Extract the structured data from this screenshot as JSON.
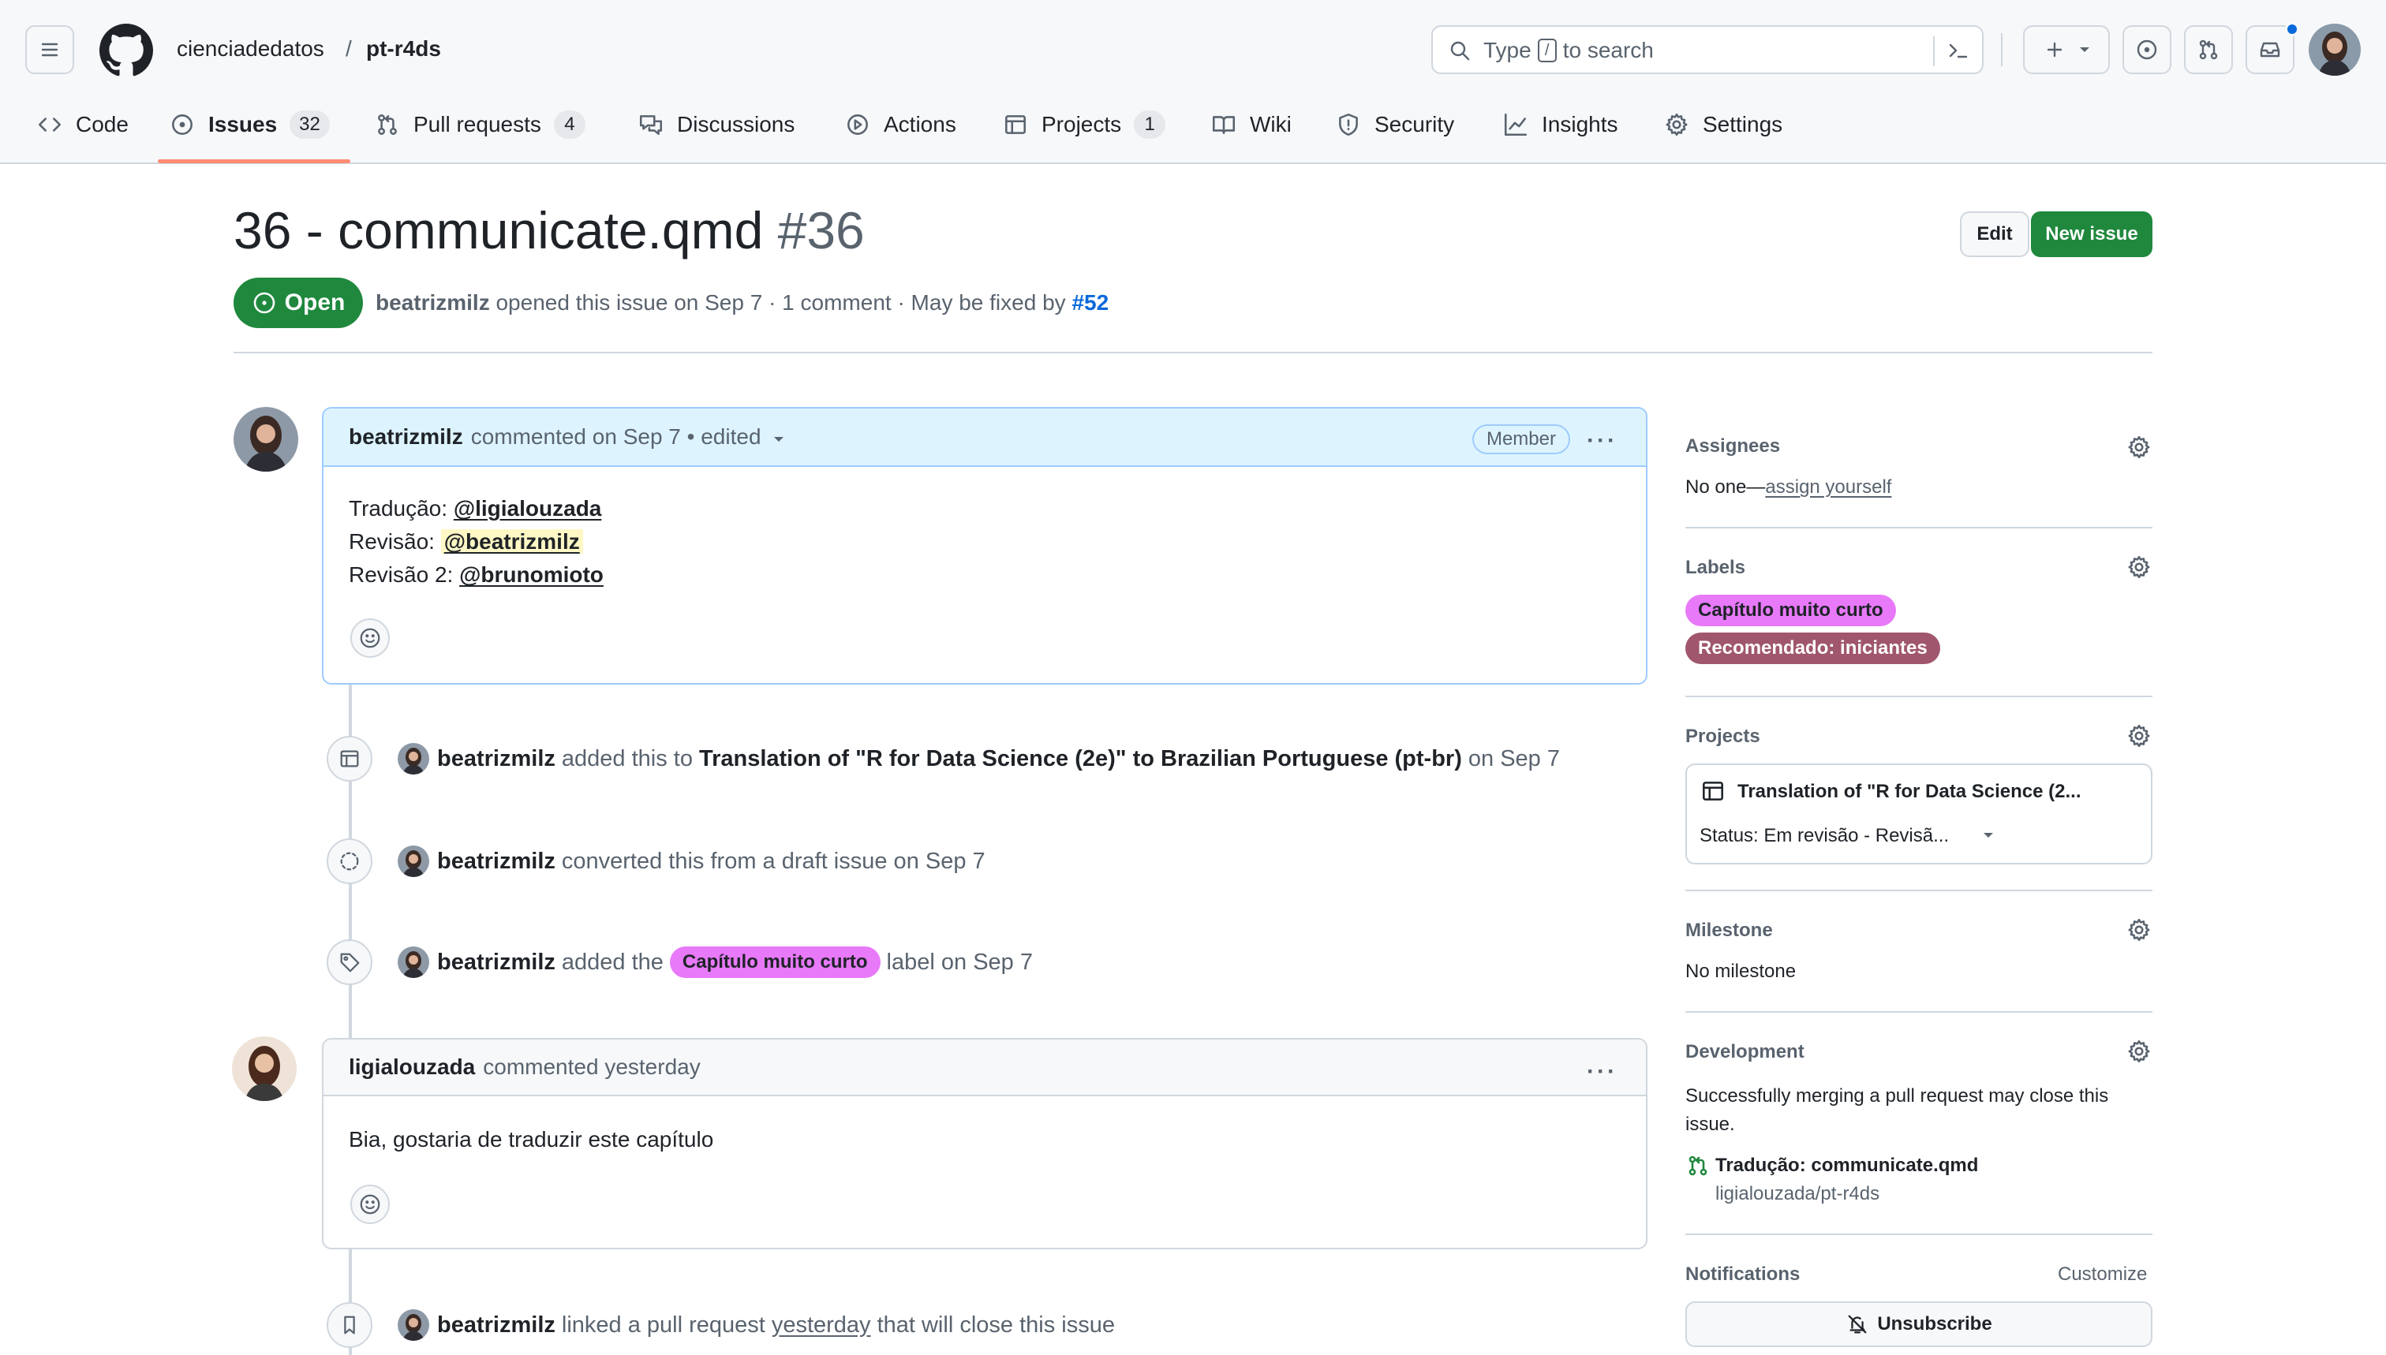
{
  "repo": {
    "owner": "cienciadedatos",
    "separator": "/",
    "name": "pt-r4ds"
  },
  "search": {
    "prefix": "Type",
    "key": "/",
    "suffix": "to search"
  },
  "colors": {
    "accent_green": "#1f883d",
    "link_blue": "#0969da",
    "tab_underline": "#fd8c73",
    "label_pink": "#e879f9",
    "label_mauve": "#a0566c",
    "notification_dot": "#0969da"
  },
  "tabs": [
    {
      "label": "Code",
      "icon": "code-icon"
    },
    {
      "label": "Issues",
      "count": "32",
      "icon": "issue-opened-icon",
      "selected": true
    },
    {
      "label": "Pull requests",
      "count": "4",
      "icon": "git-pull-request-icon"
    },
    {
      "label": "Discussions",
      "icon": "comment-discussion-icon"
    },
    {
      "label": "Actions",
      "icon": "play-icon"
    },
    {
      "label": "Projects",
      "count": "1",
      "icon": "table-icon"
    },
    {
      "label": "Wiki",
      "icon": "book-icon"
    },
    {
      "label": "Security",
      "icon": "shield-icon"
    },
    {
      "label": "Insights",
      "icon": "graph-icon"
    },
    {
      "label": "Settings",
      "icon": "gear-icon"
    }
  ],
  "issue": {
    "title": "36 - communicate.qmd",
    "number": "#36",
    "state": "Open",
    "author": "beatrizmilz",
    "meta_opened": "opened this issue on Sep 7 · 1 comment · May be fixed by",
    "fixed_by": "#52",
    "edit_label": "Edit",
    "new_issue_label": "New issue"
  },
  "comment1": {
    "author": "beatrizmilz",
    "meta": "commented on Sep 7 • edited",
    "badge": "Member",
    "lines": [
      {
        "prefix": "Tradução: ",
        "mention": "@ligialouzada"
      },
      {
        "prefix": "Revisão: ",
        "mention": "@beatrizmilz"
      },
      {
        "prefix": "Revisão 2: ",
        "mention": "@brunomioto"
      }
    ]
  },
  "events": {
    "project": {
      "actor": "beatrizmilz",
      "pre": "added this to",
      "target": "Translation of \"R for Data Science (2e)\" to Brazilian Portuguese (pt-br)",
      "post": "on Sep 7"
    },
    "converted": {
      "actor": "beatrizmilz",
      "text": "converted this from a draft issue on Sep 7"
    },
    "label": {
      "actor": "beatrizmilz",
      "pre": "added the",
      "label": "Capítulo muito curto",
      "post": "label on Sep 7"
    },
    "linked": {
      "actor": "beatrizmilz",
      "pre": "linked a pull request",
      "when": "yesterday",
      "post": "that will close this issue"
    }
  },
  "comment2": {
    "author": "ligialouzada",
    "meta": "commented yesterday",
    "body": "Bia, gostaria de traduzir este capítulo"
  },
  "sidebar": {
    "assignees": {
      "title": "Assignees",
      "text": "No one—",
      "link": "assign yourself"
    },
    "labels": {
      "title": "Labels",
      "items": [
        {
          "name": "Capítulo muito curto",
          "color": "#e879f9"
        },
        {
          "name": "Recomendado: iniciantes",
          "color": "#a0566c"
        }
      ]
    },
    "projects": {
      "title": "Projects",
      "name": "Translation of \"R for Data Science (2...",
      "status": "Status: Em revisão - Revisã..."
    },
    "milestone": {
      "title": "Milestone",
      "text": "No milestone"
    },
    "development": {
      "title": "Development",
      "text": "Successfully merging a pull request may close this issue.",
      "pr_title": "Tradução: communicate.qmd",
      "pr_repo": "ligialouzada/pt-r4ds"
    },
    "notifications": {
      "title": "Notifications",
      "customize": "Customize",
      "unsubscribe": "Unsubscribe"
    }
  }
}
